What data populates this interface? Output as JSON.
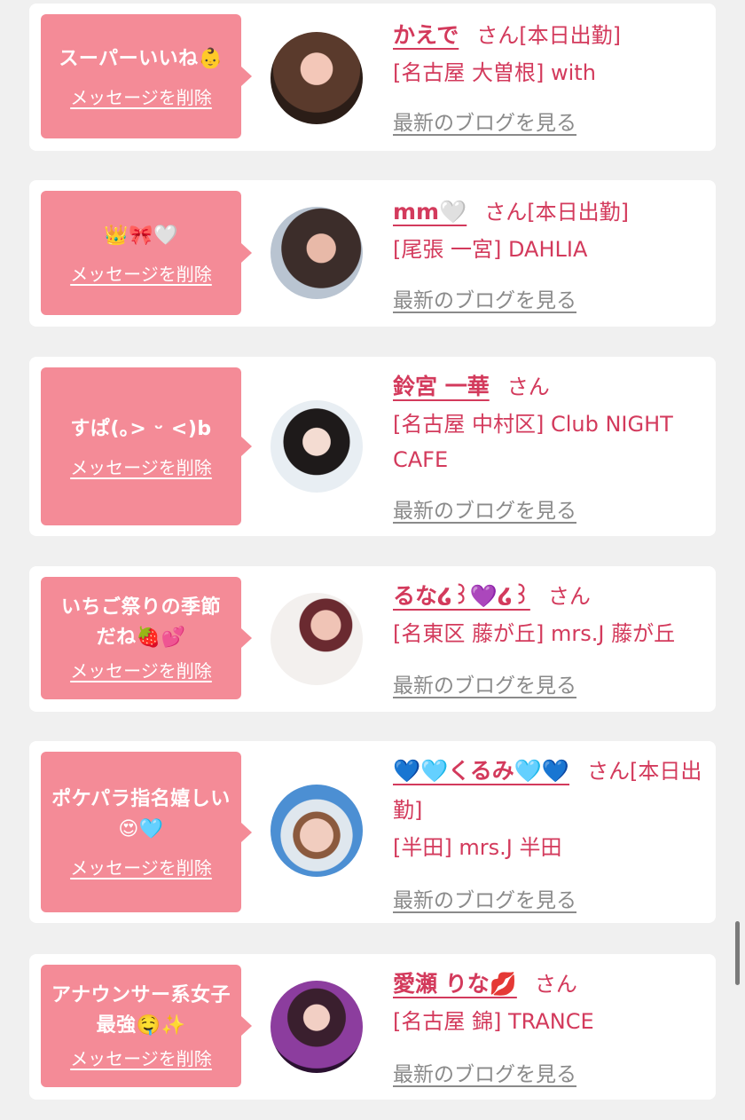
{
  "delete_label": "メッセージを削除",
  "blog_label": "最新のブログを見る",
  "colors": {
    "accent": "#d33a5c",
    "bubble": "#f48b97",
    "background": "#f0f0f0",
    "link_gray": "#8a8a8a"
  },
  "messages": [
    {
      "text": "スーパーいいね👶",
      "name": "かえで",
      "san": "さん[本日出勤]",
      "shop": "[名古屋 大曽根] with"
    },
    {
      "text": "👑🎀🤍",
      "name": "mm🤍",
      "san": "さん[本日出勤]",
      "shop": "[尾張 一宮] DAHLIA"
    },
    {
      "text": "すぱ(｡> ᵕ <)b",
      "name": "鈴宮 一華",
      "san": "さん",
      "shop": "[名古屋 中村区] Club NIGHT CAFE"
    },
    {
      "text": "いちご祭りの季節だね🍓💕",
      "name": "るな໒꒱💜໒꒱",
      "san": "さん",
      "shop": "[名東区 藤が丘] mrs.J 藤が丘"
    },
    {
      "text": "ポケパラ指名嬉しい😍🩵",
      "name": "💙🩵くるみ🩵💙",
      "san": "さん[本日出勤]",
      "shop": "[半田] mrs.J 半田"
    },
    {
      "text": "アナウンサー系女子最強🤤✨",
      "name": "愛瀬 りな💋",
      "san": "さん",
      "shop": "[名古屋 錦] TRANCE"
    }
  ]
}
